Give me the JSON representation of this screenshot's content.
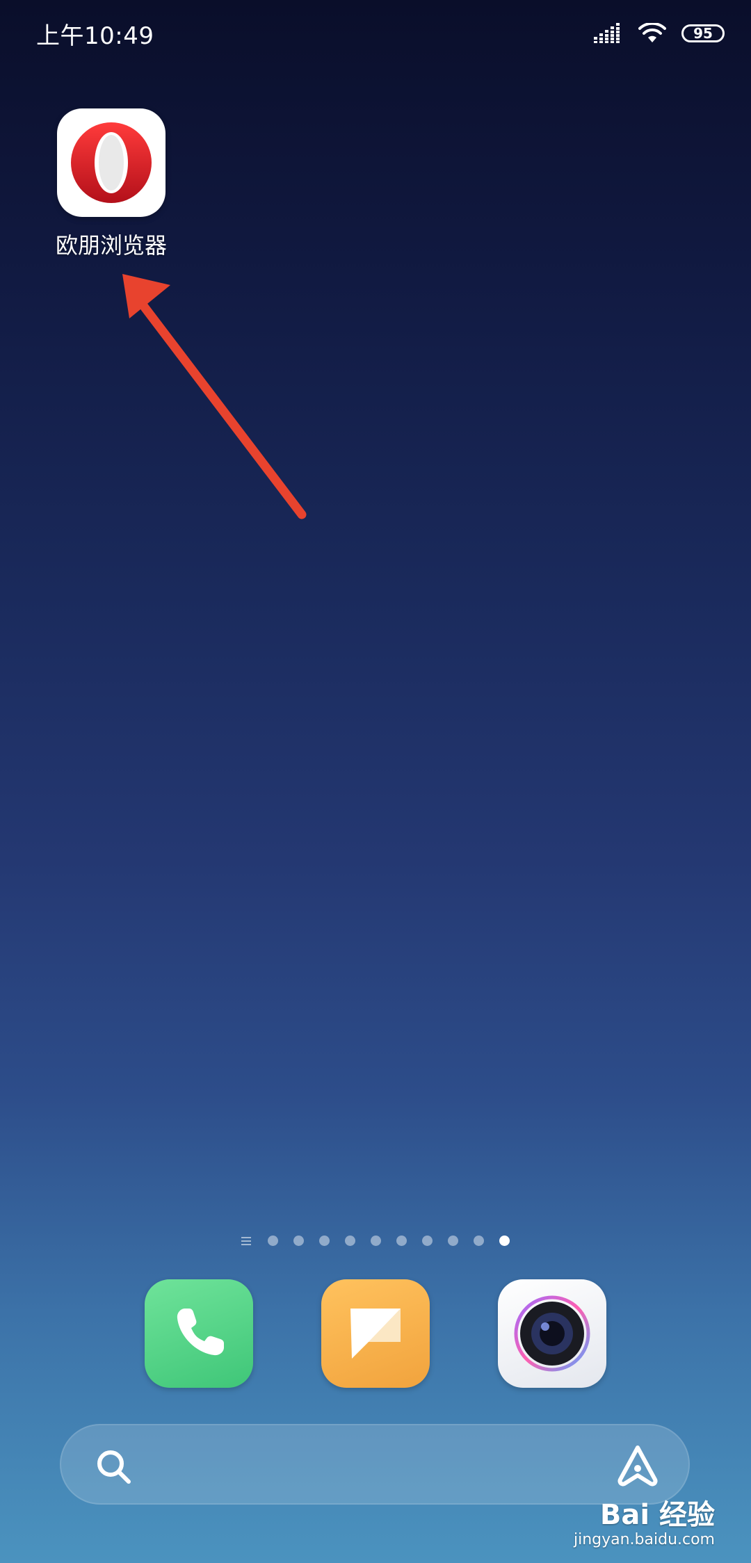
{
  "status_bar": {
    "time": "上午10:49",
    "battery_level": "95",
    "icons": [
      "signal-icon",
      "wifi-icon",
      "battery-icon"
    ]
  },
  "desktop": {
    "apps": [
      {
        "label": "欧朋浏览器",
        "icon": "opera-browser-icon",
        "icon_color": "#d8262d"
      }
    ],
    "annotation": {
      "icon": "red-arrow-icon",
      "color": "#e8432e"
    }
  },
  "page_indicator": {
    "menu_icon": "list-icon",
    "page_count": 10,
    "active_page": 10
  },
  "dock": {
    "apps": [
      {
        "icon": "phone-icon",
        "color": "#4fd484"
      },
      {
        "icon": "messages-icon",
        "color": "#f5b04a"
      },
      {
        "icon": "camera-icon",
        "color": "#f2f3f7"
      }
    ]
  },
  "search_bar": {
    "icons": [
      "search-icon",
      "assistant-icon"
    ]
  },
  "watermark": {
    "logo_text": "Bai 经验",
    "url": "jingyan.baidu.com"
  }
}
